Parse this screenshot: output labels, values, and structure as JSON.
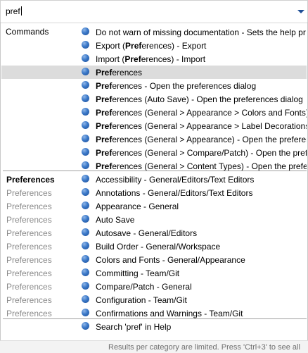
{
  "search": {
    "value": "pref"
  },
  "sections": {
    "commands": "Commands",
    "preferences": "Preferences"
  },
  "commands": [
    {
      "pre": "",
      "bold": "",
      "post": "Do not warn of missing documentation - Sets the help pr"
    },
    {
      "pre": "Export (",
      "bold": "Pref",
      "post": "erences) - Export"
    },
    {
      "pre": "Import (",
      "bold": "Pref",
      "post": "erences) - Import"
    },
    {
      "pre": "",
      "bold": "Pref",
      "post": "erences"
    },
    {
      "pre": "",
      "bold": "Pref",
      "post": "erences - Open the preferences dialog"
    },
    {
      "pre": "",
      "bold": "Pref",
      "post": "erences (Auto Save) - Open the preferences dialog"
    },
    {
      "pre": "",
      "bold": "Pref",
      "post": "erences (General > Appearance > Colors and Fonts)"
    },
    {
      "pre": "",
      "bold": "Pref",
      "post": "erences (General > Appearance > Label Decorations)"
    },
    {
      "pre": "",
      "bold": "Pref",
      "post": "erences (General > Appearance) - Open the preferen"
    },
    {
      "pre": "",
      "bold": "Pref",
      "post": "erences (General > Compare/Patch) - Open the prefe"
    },
    {
      "pre": "",
      "bold": "Pref",
      "post": "erences (General > Content Types) - Open the prefer"
    }
  ],
  "preferences": [
    "Accessibility - General/Editors/Text Editors",
    "Annotations - General/Editors/Text Editors",
    "Appearance - General",
    "Auto Save",
    "Autosave - General/Editors",
    "Build Order - General/Workspace",
    "Colors and Fonts - General/Appearance",
    "Committing - Team/Git",
    "Compare/Patch - General",
    "Configuration - Team/Git",
    "Confirmations and Warnings - Team/Git"
  ],
  "help": {
    "label": "Search 'pref' in Help"
  },
  "status": {
    "text": "Results per category are limited. Press 'Ctrl+3' to see all"
  },
  "colors": {
    "selection": "#dcdcdc",
    "dot": "#3a78c8",
    "muted": "#8a8a8a"
  }
}
